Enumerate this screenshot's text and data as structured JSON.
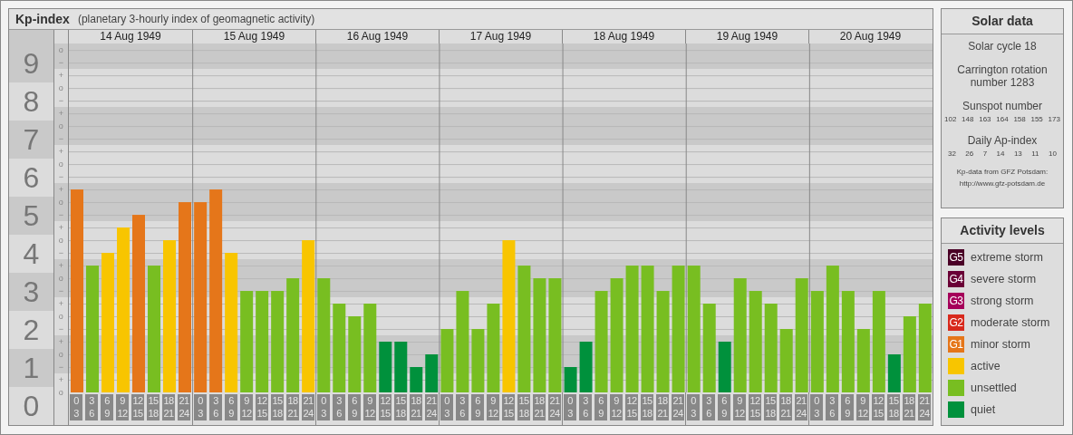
{
  "kp_panel": {
    "title": "Kp-index",
    "subtitle": "(planetary 3-hourly index of geomagnetic activity)",
    "days": [
      "14 Aug 1949",
      "15 Aug 1949",
      "16 Aug 1949",
      "17 Aug 1949",
      "18 Aug 1949",
      "19 Aug 1949",
      "20 Aug 1949"
    ],
    "sublevel_marks": [
      "o",
      "−",
      "+",
      "o",
      "−",
      "+",
      "o",
      "−",
      "+",
      "o",
      "−",
      "+",
      "o",
      "−",
      "+",
      "o",
      "−",
      "+",
      "o",
      "−",
      "+",
      "o",
      "−",
      "+",
      "o",
      "−",
      "+",
      "o"
    ],
    "chart_data": {
      "type": "bar",
      "stacked": true,
      "grid": true,
      "ylim": [
        0,
        9.17
      ],
      "yticks": [
        0,
        1,
        2,
        3,
        4,
        5,
        6,
        7,
        8,
        9
      ],
      "categories": [
        "0 3",
        "3 6",
        "6 9",
        "9 12",
        "12 15",
        "15 18",
        "18 21",
        "21 24",
        "0 3",
        "3 6",
        "6 9",
        "9 12",
        "12 15",
        "15 18",
        "18 21",
        "21 24",
        "0 3",
        "3 6",
        "6 9",
        "9 12",
        "12 15",
        "15 18",
        "18 21",
        "21 24",
        "0 3",
        "3 6",
        "6 9",
        "9 12",
        "12 15",
        "15 18",
        "18 21",
        "21 24",
        "0 3",
        "3 6",
        "6 9",
        "9 12",
        "12 15",
        "15 18",
        "18 21",
        "21 24",
        "0 3",
        "3 6",
        "6 9",
        "9 12",
        "12 15",
        "15 18",
        "18 21",
        "21 24",
        "0 3",
        "3 6",
        "6 9",
        "9 12",
        "12 15",
        "15 18",
        "18 21",
        "21 24"
      ],
      "series": [
        {
          "color": "#00913c",
          "values": [
            null,
            null,
            null,
            null,
            null,
            null,
            null,
            null,
            null,
            null,
            null,
            null,
            null,
            null,
            null,
            null,
            null,
            null,
            null,
            null,
            1.33,
            1.33,
            0.67,
            1,
            null,
            null,
            null,
            null,
            null,
            null,
            null,
            null,
            0.67,
            1.33,
            null,
            null,
            null,
            null,
            null,
            null,
            null,
            null,
            1.33,
            null,
            null,
            null,
            null,
            null,
            null,
            null,
            null,
            null,
            null,
            1,
            null,
            null
          ]
        },
        {
          "color": "#78be21",
          "values": [
            null,
            3.33,
            null,
            null,
            null,
            3.33,
            null,
            null,
            null,
            null,
            null,
            2.67,
            2.67,
            2.67,
            3,
            null,
            3,
            2.33,
            2,
            2.33,
            null,
            null,
            null,
            null,
            1.67,
            2.67,
            1.67,
            2.33,
            null,
            3.33,
            3,
            3,
            null,
            null,
            2.67,
            3,
            3.33,
            3.33,
            2.67,
            3.33,
            3.33,
            2.33,
            null,
            3,
            2.67,
            2.33,
            1.67,
            3,
            2.67,
            3.33,
            2.67,
            1.67,
            2.67,
            null,
            2,
            2.33
          ]
        },
        {
          "color": "#f8c500",
          "values": [
            null,
            null,
            3.67,
            4.33,
            null,
            null,
            4,
            null,
            null,
            null,
            3.67,
            null,
            null,
            null,
            null,
            4,
            null,
            null,
            null,
            null,
            null,
            null,
            null,
            null,
            null,
            null,
            null,
            null,
            4,
            null,
            null,
            null,
            null,
            null,
            null,
            null,
            null,
            null,
            null,
            null,
            null,
            null,
            null,
            null,
            null,
            null,
            null,
            null,
            null,
            null,
            null,
            null,
            null,
            null,
            null,
            null
          ]
        },
        {
          "color": "#e5761a",
          "values": [
            5.33,
            null,
            null,
            null,
            4.67,
            null,
            null,
            5,
            5,
            5.33,
            null,
            null,
            null,
            null,
            null,
            null,
            null,
            null,
            null,
            null,
            null,
            null,
            null,
            null,
            null,
            null,
            null,
            null,
            null,
            null,
            null,
            null,
            null,
            null,
            null,
            null,
            null,
            null,
            null,
            null,
            null,
            null,
            null,
            null,
            null,
            null,
            null,
            null,
            null,
            null,
            null,
            null,
            null,
            null,
            null,
            null
          ]
        }
      ]
    }
  },
  "solar_data": {
    "title": "Solar data",
    "solar_cycle": "Solar cycle 18",
    "carrington": "Carrington rotation number 1283",
    "sunspot_label": "Sunspot number",
    "sunspot_values": [
      "102",
      "148",
      "163",
      "164",
      "158",
      "155",
      "173"
    ],
    "ap_label": "Daily Ap-index",
    "ap_values": [
      "32",
      "26",
      "7",
      "14",
      "13",
      "11",
      "10"
    ],
    "credit": [
      "Kp-data from GFZ Potsdam:",
      "http://www.gfz-potsdam.de"
    ]
  },
  "activity_levels": {
    "title": "Activity levels",
    "items": [
      {
        "badge": "G5",
        "label": "extreme storm",
        "color": "#4a0026"
      },
      {
        "badge": "G4",
        "label": "severe storm",
        "color": "#6a0036"
      },
      {
        "badge": "G3",
        "label": "strong storm",
        "color": "#a5005a"
      },
      {
        "badge": "G2",
        "label": "moderate storm",
        "color": "#d8291c"
      },
      {
        "badge": "G1",
        "label": "minor storm",
        "color": "#e5761a"
      },
      {
        "label": "active",
        "color": "#f8c500"
      },
      {
        "label": "unsettled",
        "color": "#78be21"
      },
      {
        "label": "quiet",
        "color": "#00913c"
      }
    ]
  }
}
